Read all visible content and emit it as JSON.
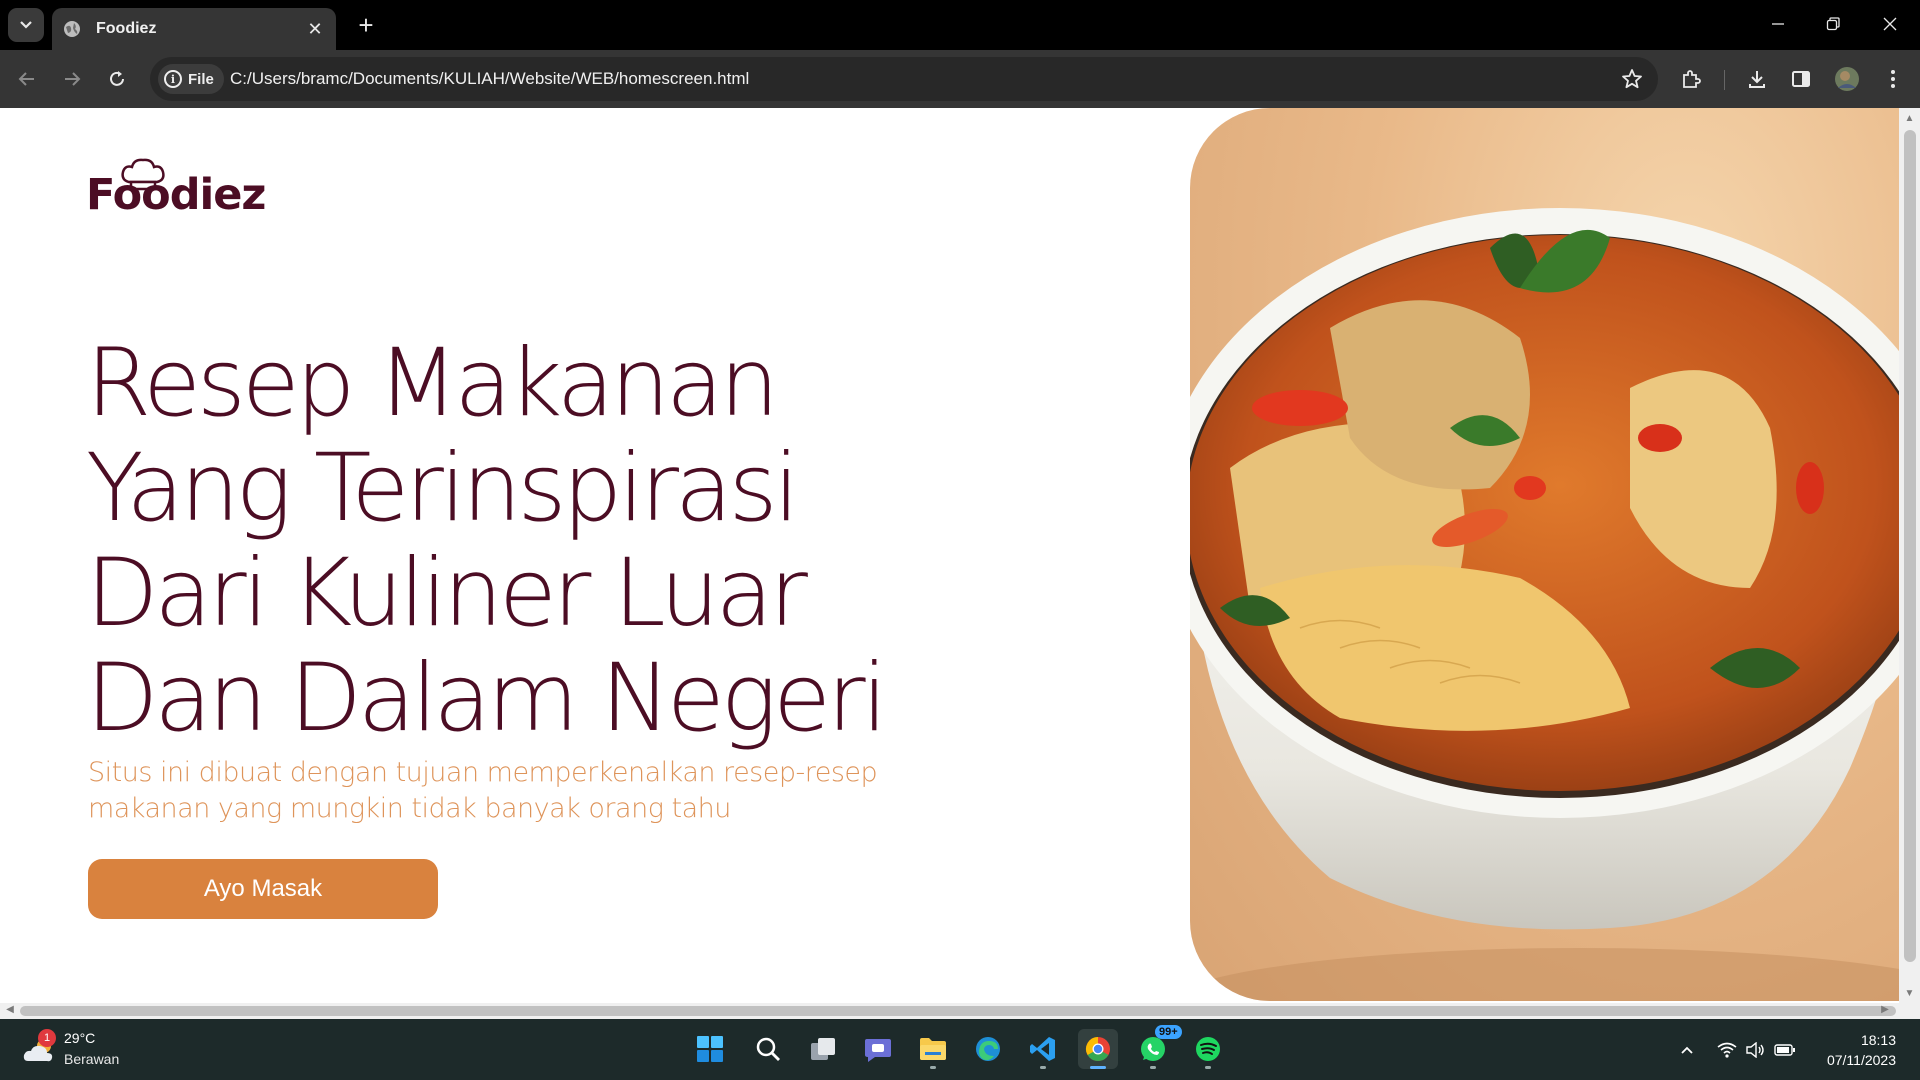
{
  "browser": {
    "tab_title": "Foodiez",
    "chip_label": "File",
    "url": "C:/Users/bramc/Documents/KULIAH/Website/WEB/homescreen.html"
  },
  "page": {
    "logo_text": "Foodiez",
    "headline": [
      "Resep Makanan",
      "Yang Terinspirasi",
      "Dari Kuliner Luar",
      "Dan Dalam Negeri"
    ],
    "subtitle": "Situs ini dibuat dengan tujuan memperkenalkan resep-resep makanan yang mungkin tidak banyak orang tahu",
    "cta_label": "Ayo Masak",
    "colors": {
      "primary": "#4c0d24",
      "accent": "#d9823e"
    }
  },
  "taskbar": {
    "weather_temp": "29°C",
    "weather_cond": "Berawan",
    "weather_badge": "1",
    "whatsapp_badge": "99+",
    "time": "18:13",
    "date": "07/11/2023"
  }
}
